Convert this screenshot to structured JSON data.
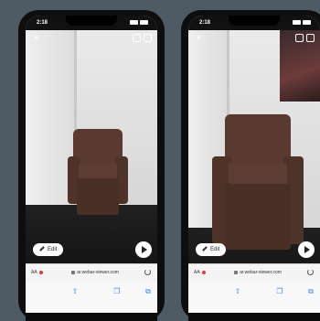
{
  "phones": [
    {
      "status_time": "2:18",
      "edit_label": "Edit",
      "aa_label": "AA",
      "url": "ar.webar-viewer.com",
      "icons": [
        "close-icon",
        "screenshot-icon",
        "frame-icon",
        "pencil-icon",
        "play-icon",
        "reload-icon",
        "share-icon",
        "book-icon",
        "tabs-icon"
      ]
    },
    {
      "status_time": "2:18",
      "edit_label": "Edit",
      "aa_label": "AA",
      "url": "ar.webar-viewer.com",
      "icons": [
        "close-icon",
        "screenshot-icon",
        "frame-icon",
        "pencil-icon",
        "play-icon",
        "reload-icon",
        "share-icon",
        "book-icon",
        "tabs-icon"
      ]
    }
  ],
  "colors": {
    "background": "#4e5b64",
    "chair": "#5a3a30",
    "toolbar_icons": "#3b82f6"
  }
}
